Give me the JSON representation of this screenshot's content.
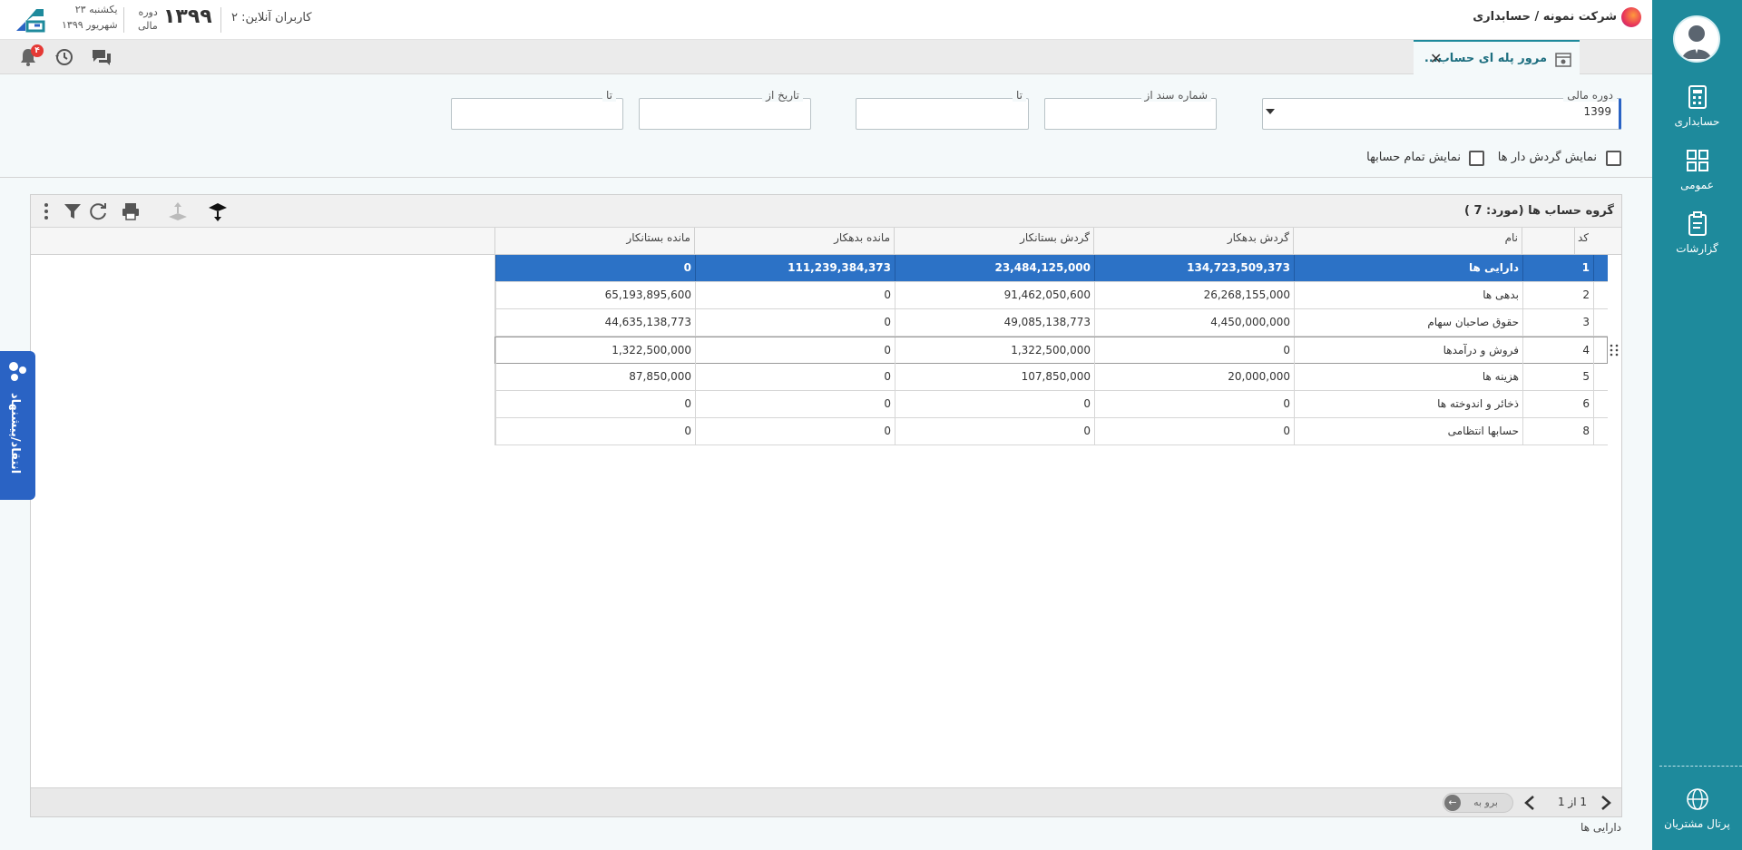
{
  "header": {
    "brand": "شرکت نمونه / حسابداری",
    "online_users": "کاربران آنلاین: ۲",
    "fiscal_year": "۱۳۹۹",
    "fiscal_label_line1": "دوره",
    "fiscal_label_line2": "مالی",
    "date_line1": "یکشنبه ۲۳",
    "date_line2": "شهریور ۱۳۹۹",
    "notifications_count": "۴"
  },
  "tabs": [
    {
      "label": "مرور پله ای حساب..."
    }
  ],
  "sidebar": {
    "items": [
      {
        "label": "حسابداری",
        "icon": "accounting-icon"
      },
      {
        "label": "عمومی",
        "icon": "general-icon"
      },
      {
        "label": "گزارشات",
        "icon": "reports-icon"
      }
    ],
    "portal": "پرتال مشتریان"
  },
  "filters": {
    "fiscal_period_label": "دوره مالی",
    "fiscal_period_value": "1399",
    "doc_from_label": "شماره سند از",
    "doc_to_label": "تا",
    "date_from_label": "تاریخ از",
    "date_to_label": "تا",
    "show_turnover_label": "نمایش گردش دار ها",
    "show_all_accounts_label": "نمایش تمام حسابها"
  },
  "grid": {
    "title": "گروه حساب ها",
    "count_text": "(مورد:  7 )",
    "columns": [
      "کد",
      "نام",
      "گردش بدهکار",
      "گردش بستانکار",
      "مانده بدهکار",
      "مانده بستانکار"
    ],
    "rows": [
      {
        "code": "1",
        "name": "دارایی ها",
        "debit_turnover": "134,723,509,373",
        "credit_turnover": "23,484,125,000",
        "debit_balance": "111,239,384,373",
        "credit_balance": "0"
      },
      {
        "code": "2",
        "name": "بدهی ها",
        "debit_turnover": "26,268,155,000",
        "credit_turnover": "91,462,050,600",
        "debit_balance": "0",
        "credit_balance": "65,193,895,600"
      },
      {
        "code": "3",
        "name": "حقوق صاحبان سهام",
        "debit_turnover": "4,450,000,000",
        "credit_turnover": "49,085,138,773",
        "debit_balance": "0",
        "credit_balance": "44,635,138,773"
      },
      {
        "code": "4",
        "name": "فروش و درآمدها",
        "debit_turnover": "0",
        "credit_turnover": "1,322,500,000",
        "debit_balance": "0",
        "credit_balance": "1,322,500,000"
      },
      {
        "code": "5",
        "name": "هزینه ها",
        "debit_turnover": "20,000,000",
        "credit_turnover": "107,850,000",
        "debit_balance": "0",
        "credit_balance": "87,850,000"
      },
      {
        "code": "6",
        "name": "ذخائر و اندوخته ها",
        "debit_turnover": "0",
        "credit_turnover": "0",
        "debit_balance": "0",
        "credit_balance": "0"
      },
      {
        "code": "8",
        "name": "حسابها انتظامی",
        "debit_turnover": "0",
        "credit_turnover": "0",
        "debit_balance": "0",
        "credit_balance": "0"
      }
    ],
    "pager": {
      "text": "1 از 1",
      "goto_placeholder": "برو به"
    },
    "selected_path": "دارایی ها"
  },
  "feedback_label": "انتقاد/پیشنهاد",
  "colors": {
    "sidebar": "#1e8a9c",
    "selected_row": "#2c72c6",
    "feedback": "#2a63c4"
  }
}
